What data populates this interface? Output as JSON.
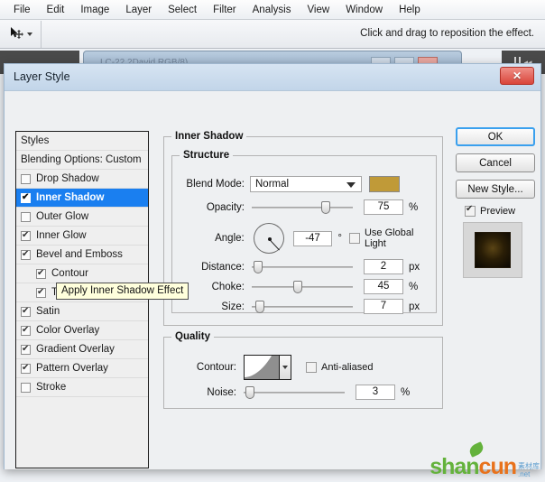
{
  "app": {
    "menus": [
      "File",
      "Edit",
      "Image",
      "Layer",
      "Select",
      "Filter",
      "Analysis",
      "View",
      "Window",
      "Help"
    ],
    "options_hint": "Click and drag to reposition the effect.",
    "tool_icon": "move-tool-icon",
    "document_title": "LC-22.2David RGB/8)"
  },
  "dialog": {
    "title": "Layer Style",
    "close_label": "✕",
    "styles": [
      {
        "label": "Styles",
        "type": "header"
      },
      {
        "label": "Blending Options: Custom",
        "type": "header"
      },
      {
        "label": "Drop Shadow",
        "checked": false,
        "selected": false,
        "indent": false
      },
      {
        "label": "Inner Shadow",
        "checked": true,
        "selected": true,
        "indent": false
      },
      {
        "label": "Outer Glow",
        "checked": false,
        "selected": false,
        "indent": false
      },
      {
        "label": "Inner Glow",
        "checked": true,
        "selected": false,
        "indent": false
      },
      {
        "label": "Bevel and Emboss",
        "checked": true,
        "selected": false,
        "indent": false
      },
      {
        "label": "Contour",
        "checked": true,
        "selected": false,
        "indent": true
      },
      {
        "label": "Texture",
        "checked": true,
        "selected": false,
        "indent": true
      },
      {
        "label": "Satin",
        "checked": true,
        "selected": false,
        "indent": false
      },
      {
        "label": "Color Overlay",
        "checked": true,
        "selected": false,
        "indent": false
      },
      {
        "label": "Gradient Overlay",
        "checked": true,
        "selected": false,
        "indent": false
      },
      {
        "label": "Pattern Overlay",
        "checked": true,
        "selected": false,
        "indent": false
      },
      {
        "label": "Stroke",
        "checked": false,
        "selected": false,
        "indent": false
      }
    ],
    "tooltip": "Apply Inner Shadow Effect",
    "panel": {
      "title": "Inner Shadow",
      "structure": {
        "legend": "Structure",
        "blend_mode_label": "Blend Mode:",
        "blend_mode_value": "Normal",
        "color_swatch": "#c09a38",
        "opacity_label": "Opacity:",
        "opacity_value": "75",
        "opacity_unit": "%",
        "angle_label": "Angle:",
        "angle_value": "-47",
        "angle_unit": "°",
        "use_global_light_label": "Use Global Light",
        "use_global_light_checked": false,
        "distance_label": "Distance:",
        "distance_value": "2",
        "distance_unit": "px",
        "choke_label": "Choke:",
        "choke_value": "45",
        "choke_unit": "%",
        "size_label": "Size:",
        "size_value": "7",
        "size_unit": "px"
      },
      "quality": {
        "legend": "Quality",
        "contour_label": "Contour:",
        "anti_aliased_label": "Anti-aliased",
        "anti_aliased_checked": false,
        "noise_label": "Noise:",
        "noise_value": "3",
        "noise_unit": "%"
      }
    },
    "buttons": {
      "ok": "OK",
      "cancel": "Cancel",
      "new_style": "New Style...",
      "preview": "Preview",
      "preview_checked": true
    }
  },
  "watermark": {
    "part1": "shan",
    "part2": "cun",
    "sub_top": "素材库",
    "sub_bottom": ".net"
  }
}
